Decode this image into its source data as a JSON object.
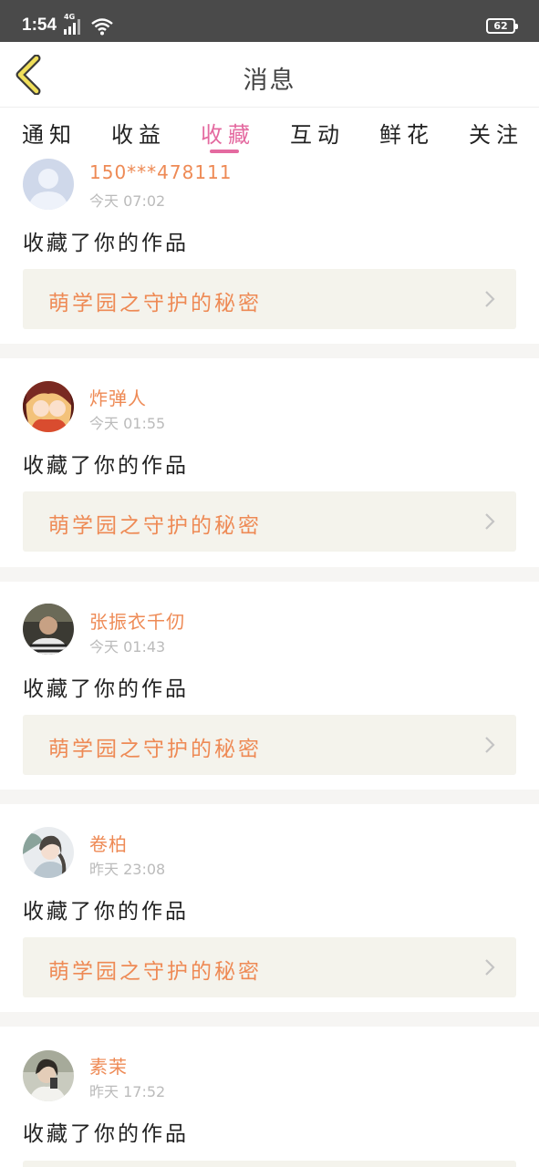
{
  "status_bar": {
    "time": "1:54",
    "network": "4G",
    "battery": "62"
  },
  "header": {
    "title": "消息"
  },
  "tabs": [
    {
      "label": "通知",
      "active": false
    },
    {
      "label": "收益",
      "active": false
    },
    {
      "label": "收藏",
      "active": true
    },
    {
      "label": "互动",
      "active": false
    },
    {
      "label": "鲜花",
      "active": false
    },
    {
      "label": "关注",
      "active": false
    }
  ],
  "colors": {
    "accent_pink": "#e46aa0",
    "name_orange": "#ee8a55",
    "box_bg": "#f4f3ec",
    "back_arrow": "#f0df5a"
  },
  "messages": [
    {
      "user": "150***478111",
      "time": "今天 07:02",
      "action": "收藏了你的作品",
      "work": "萌学园之守护的秘密",
      "avatar": "default-avatar"
    },
    {
      "user": "炸弹人",
      "time": "今天 01:55",
      "action": "收藏了你的作品",
      "work": "萌学园之守护的秘密",
      "avatar": "anime-avatar"
    },
    {
      "user": "张振衣千仞",
      "time": "今天 01:43",
      "action": "收藏了你的作品",
      "work": "萌学园之守护的秘密",
      "avatar": "photo-avatar"
    },
    {
      "user": "卷柏",
      "time": "昨天 23:08",
      "action": "收藏了你的作品",
      "work": "萌学园之守护的秘密",
      "avatar": "illustration-avatar"
    },
    {
      "user": "素茉",
      "time": "昨天 17:52",
      "action": "收藏了你的作品",
      "work": "",
      "avatar": "selfie-avatar"
    }
  ]
}
